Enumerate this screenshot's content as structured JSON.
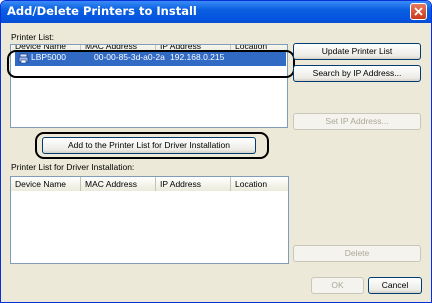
{
  "window": {
    "title": "Add/Delete Printers to Install"
  },
  "printer_list": {
    "label": "Printer List:",
    "columns": [
      "Device Name",
      "MAC Address",
      "IP Address",
      "Location"
    ],
    "selected_row": {
      "device": "LBP5000",
      "mac": "00-00-85-3d-a0-2a",
      "ip": "192.168.0.215"
    }
  },
  "buttons": {
    "update": "Update Printer List",
    "search": "Search by IP Address...",
    "set_ip": "Set IP Address...",
    "add": "Add to the Printer List for Driver Installation",
    "delete": "Delete",
    "ok": "OK",
    "cancel": "Cancel"
  },
  "driver_list": {
    "label": "Printer List for Driver Installation:",
    "columns": [
      "Device Name",
      "MAC Address",
      "IP Address",
      "Location"
    ]
  }
}
